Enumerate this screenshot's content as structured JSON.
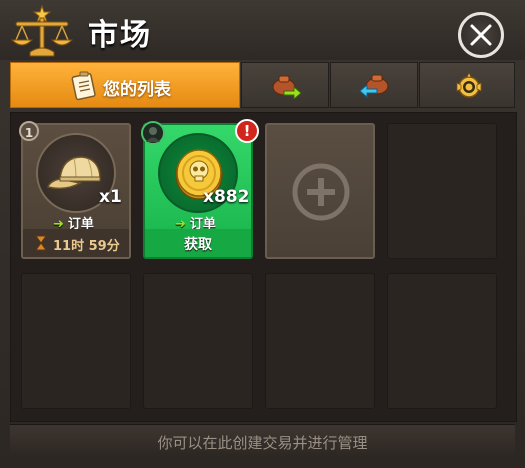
{
  "header": {
    "title": "市场"
  },
  "tabs": [
    {
      "label": "您的列表",
      "icon": "notepad-icon",
      "active": true
    },
    {
      "label": "",
      "icon": "bag-arrow-right-icon",
      "active": false
    },
    {
      "label": "",
      "icon": "bag-arrow-left-icon",
      "active": false
    },
    {
      "label": "",
      "icon": "gold-coin-emblem-icon",
      "active": false
    }
  ],
  "slots": {
    "cap": {
      "slot_number": "1",
      "quantity": "x1",
      "order_label": "订单",
      "timer": "11时 59分",
      "icon": "baseball-cap-icon"
    },
    "coin": {
      "quantity": "x882",
      "order_label": "订单",
      "action_label": "获取",
      "alert": "!",
      "icon": "skull-gold-coin-icon"
    },
    "add": {
      "icon": "plus-icon"
    }
  },
  "footer": {
    "hint": "你可以在此创建交易并进行管理"
  },
  "colors": {
    "active_tab": "#f39a1f",
    "claim_green": "#1cc24f",
    "alert_red": "#d2251c",
    "order_arrow": "#9be21a"
  }
}
